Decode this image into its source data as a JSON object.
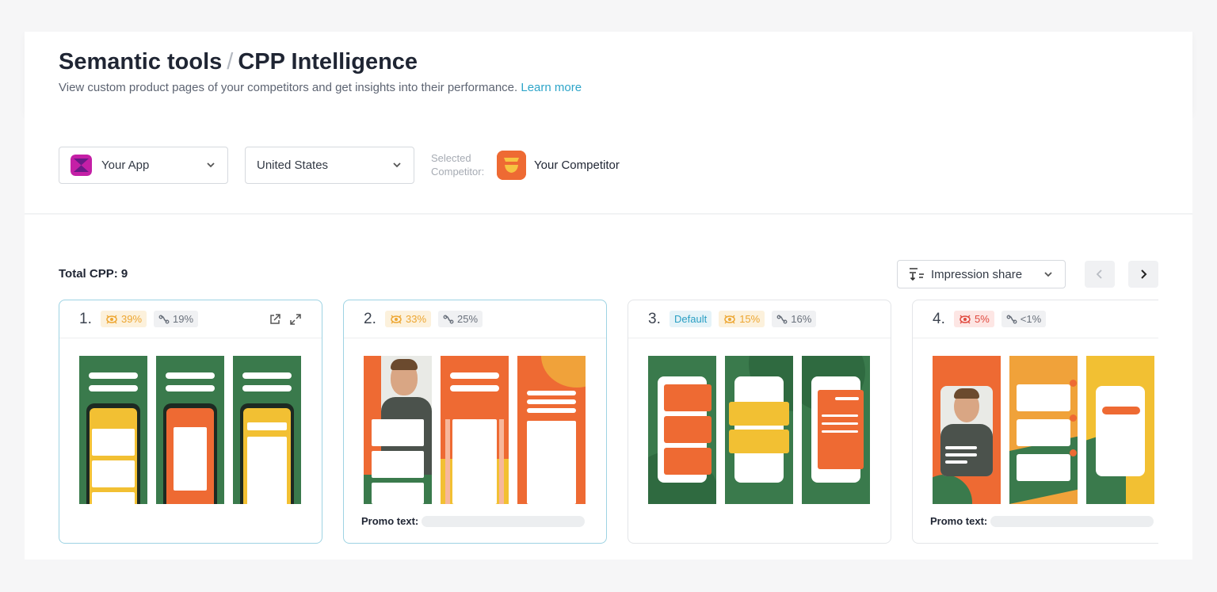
{
  "header": {
    "breadcrumb_root": "Semantic tools",
    "breadcrumb_separator": "/",
    "breadcrumb_current": "CPP Intelligence",
    "subtitle": "View custom product pages of your competitors and get insights into their performance.",
    "learn_more": "Learn more"
  },
  "filters": {
    "app_select": "Your App",
    "country_select": "United States",
    "selected_competitor_label_line1": "Selected",
    "selected_competitor_label_line2": "Competitor:",
    "competitor_name": "Your Competitor"
  },
  "content": {
    "total_label": "Total CPP: 9",
    "sort_select": "Impression share"
  },
  "colors": {
    "accent": "#2ea5c9",
    "orange": "#ee6a33",
    "green": "#3a7a4c",
    "yellow": "#f2c033",
    "app_icon": "#c41fa6"
  },
  "cards": [
    {
      "rank": "1.",
      "default_badge": "",
      "impression": "39%",
      "conversion": "19%",
      "impression_level": "high",
      "promo_label": "",
      "has_actions": true
    },
    {
      "rank": "2.",
      "default_badge": "",
      "impression": "33%",
      "conversion": "25%",
      "impression_level": "high",
      "promo_label": "Promo text:",
      "has_actions": false
    },
    {
      "rank": "3.",
      "default_badge": "Default",
      "impression": "15%",
      "conversion": "16%",
      "impression_level": "high",
      "promo_label": "",
      "has_actions": false
    },
    {
      "rank": "4.",
      "default_badge": "",
      "impression": "5%",
      "conversion": "<1%",
      "impression_level": "low",
      "promo_label": "Promo text:",
      "has_actions": false
    }
  ]
}
